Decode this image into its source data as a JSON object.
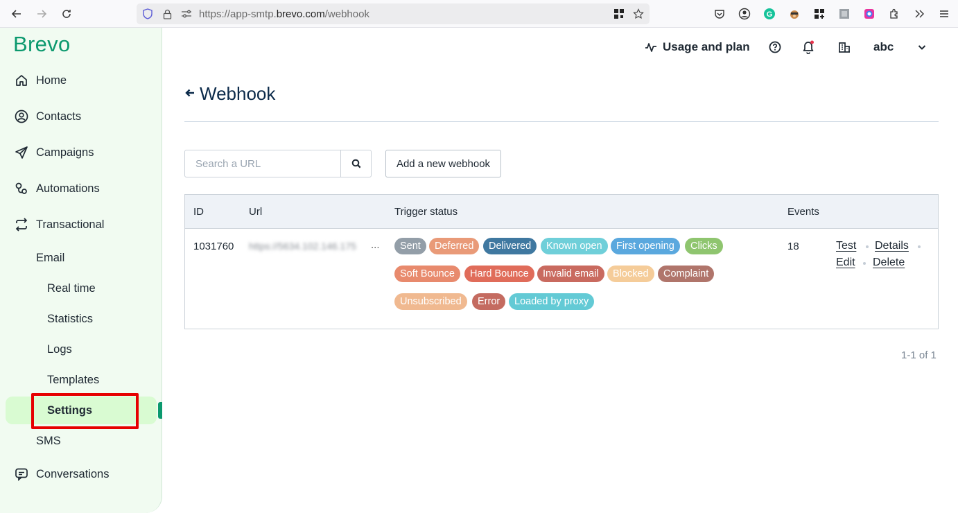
{
  "browser": {
    "url_prefix": "https://app-smtp.",
    "url_domain": "brevo.com",
    "url_path": "/webhook"
  },
  "sidebar": {
    "logo": "Brevo",
    "items": [
      {
        "label": "Home",
        "icon": "home-icon"
      },
      {
        "label": "Contacts",
        "icon": "contacts-icon"
      },
      {
        "label": "Campaigns",
        "icon": "send-icon"
      },
      {
        "label": "Automations",
        "icon": "automations-icon"
      },
      {
        "label": "Transactional",
        "icon": "transactional-icon"
      }
    ],
    "email_label": "Email",
    "email_sub": [
      "Real time",
      "Statistics",
      "Logs",
      "Templates",
      "Settings"
    ],
    "sms_label": "SMS",
    "conversations_label": "Conversations",
    "active_item": "Settings"
  },
  "header": {
    "usage_label": "Usage and plan",
    "account_name": "abc"
  },
  "page": {
    "title": "Webhook",
    "search_placeholder": "Search a URL",
    "add_button": "Add a new webhook"
  },
  "table": {
    "headers": {
      "id": "ID",
      "url": "Url",
      "trigger": "Trigger status",
      "events": "Events"
    },
    "row": {
      "id": "1031760",
      "url_blurred": "https://5634.102.146.175",
      "url_ellipsis": "...",
      "events": "18",
      "actions": [
        "Test",
        "Details",
        "Edit",
        "Delete"
      ],
      "badges": [
        {
          "label": "Sent",
          "color": "#939ea8"
        },
        {
          "label": "Deferred",
          "color": "#e99a78"
        },
        {
          "label": "Delivered",
          "color": "#3f78a0"
        },
        {
          "label": "Known open",
          "color": "#6fcfd9"
        },
        {
          "label": "First opening",
          "color": "#5aa8de"
        },
        {
          "label": "Clicks",
          "color": "#8fc56f"
        },
        {
          "label": "Soft Bounce",
          "color": "#e88a6d"
        },
        {
          "label": "Hard Bounce",
          "color": "#e06c5a"
        },
        {
          "label": "Invalid email",
          "color": "#c96a5f"
        },
        {
          "label": "Blocked",
          "color": "#f5cc99"
        },
        {
          "label": "Complaint",
          "color": "#b0756b"
        },
        {
          "label": "Unsubscribed",
          "color": "#f0b990"
        },
        {
          "label": "Error",
          "color": "#c46b60"
        },
        {
          "label": "Loaded by proxy",
          "color": "#63cad5"
        }
      ]
    }
  },
  "pagination": "1-1 of 1"
}
